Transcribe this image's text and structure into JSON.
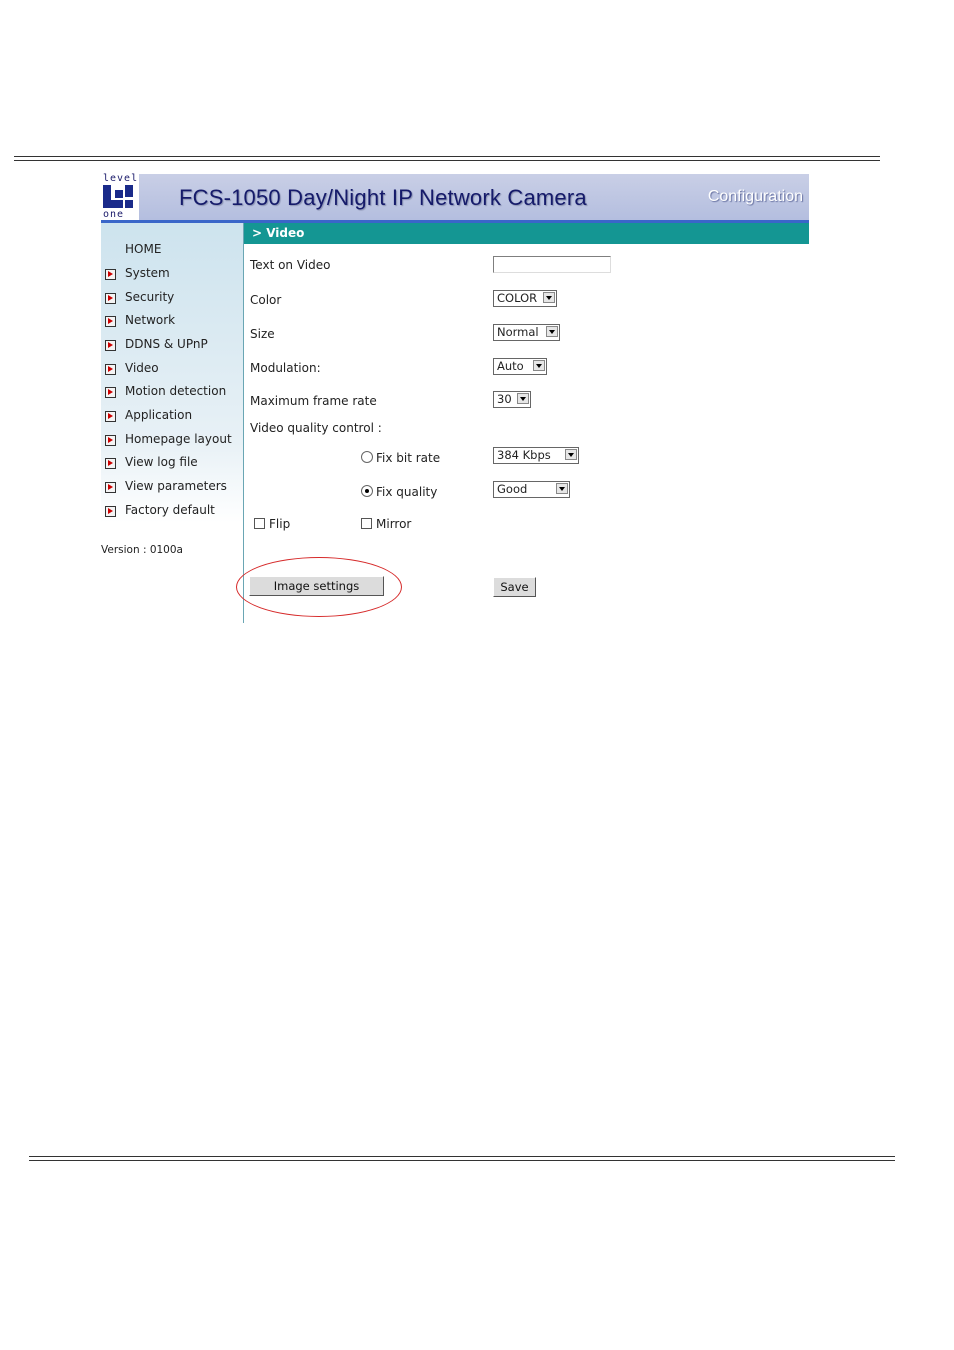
{
  "header": {
    "logo_top": "level",
    "logo_bottom": "one",
    "title": "FCS-1050  Day/Night IP Network Camera",
    "section": "Configuration"
  },
  "sidebar": {
    "home": "HOME",
    "items": [
      {
        "label": "System"
      },
      {
        "label": "Security"
      },
      {
        "label": "Network"
      },
      {
        "label": "DDNS & UPnP"
      },
      {
        "label": "Video"
      },
      {
        "label": "Motion detection"
      },
      {
        "label": "Application"
      },
      {
        "label": "Homepage layout"
      },
      {
        "label": "View log file"
      },
      {
        "label": "View parameters"
      },
      {
        "label": "Factory default"
      }
    ],
    "version": "Version : 0100a"
  },
  "content": {
    "breadcrumb": "> Video",
    "text_on_video": {
      "label": "Text on Video",
      "value": ""
    },
    "color": {
      "label": "Color",
      "value": "COLOR"
    },
    "size": {
      "label": "Size",
      "value": "Normal"
    },
    "modulation": {
      "label": "Modulation:",
      "value": "Auto"
    },
    "max_frame_rate": {
      "label": "Maximum frame rate",
      "value": "30"
    },
    "quality_control": {
      "label": "Video quality control :"
    },
    "fix_bit_rate": {
      "label": "Fix bit rate",
      "value": "384 Kbps",
      "checked": false
    },
    "fix_quality": {
      "label": "Fix quality",
      "value": "Good",
      "checked": true
    },
    "flip": {
      "label": "Flip",
      "checked": false
    },
    "mirror": {
      "label": "Mirror",
      "checked": false
    },
    "image_settings_button": "Image settings",
    "save_button": "Save"
  },
  "colors": {
    "accent_bar": "#149693",
    "banner": "#c1c9e4",
    "highlight_ellipse": "#d62a2a"
  }
}
